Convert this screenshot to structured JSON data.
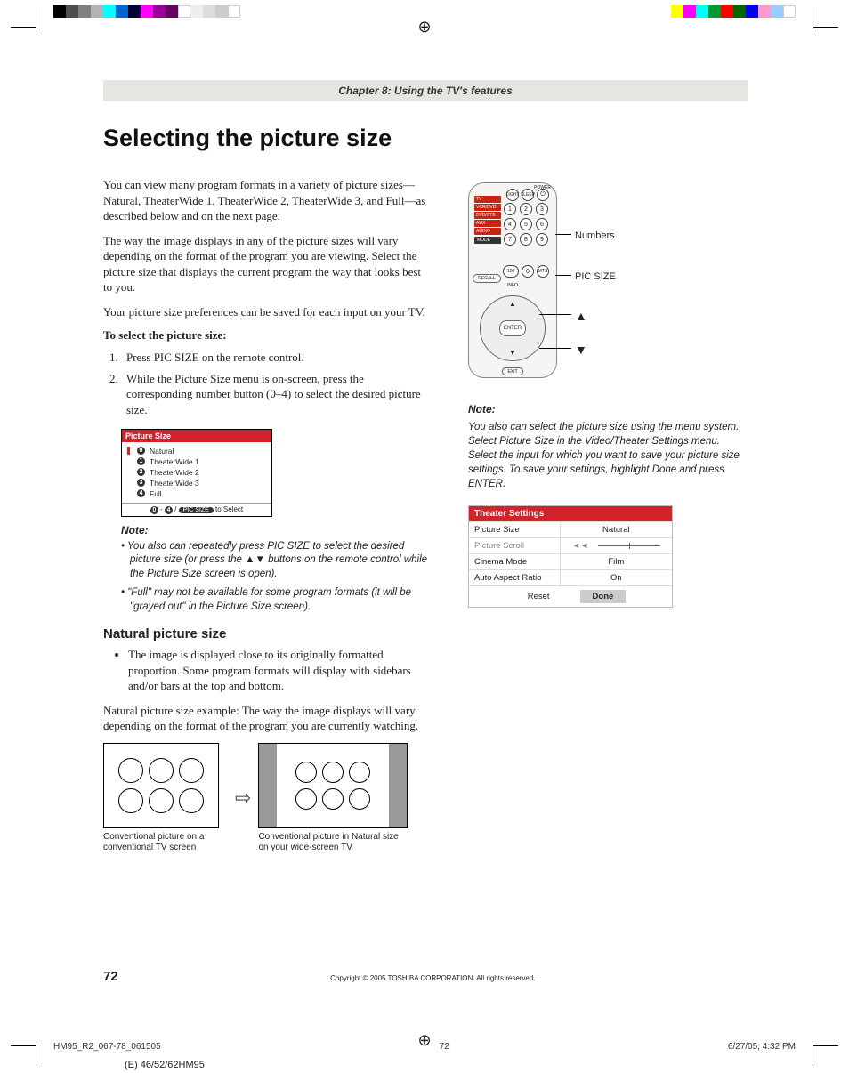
{
  "chapter": "Chapter 8: Using the TV's features",
  "title": "Selecting the picture size",
  "intro": {
    "p1": "You can view many program formats in a variety of picture sizes—Natural, TheaterWide 1, TheaterWide 2, TheaterWide 3, and Full—as described below and on the next page.",
    "p2": "The way the image displays in any of the picture sizes will vary depending on the format of the program you are viewing. Select the picture size that displays the current program the way that looks best to you.",
    "p3": "Your picture size preferences can be saved for each input on your TV."
  },
  "procedure": {
    "heading": "To select the picture size:",
    "s1": "Press PIC SIZE on the remote control.",
    "s2": "While the Picture Size menu is on-screen, press the corresponding number button (0–4) to select the desired picture size."
  },
  "osd": {
    "title": "Picture Size",
    "items": [
      {
        "num": "0",
        "label": "Natural",
        "hl": true
      },
      {
        "num": "1",
        "label": "TheaterWide 1"
      },
      {
        "num": "2",
        "label": "TheaterWide 2"
      },
      {
        "num": "3",
        "label": "TheaterWide 3"
      },
      {
        "num": "4",
        "label": "Full"
      }
    ],
    "footer_prefix": "0",
    "footer_dash": " - ",
    "footer_num2": "4",
    "footer_sep": " / ",
    "footer_pill": "PIC SIZE",
    "footer_suffix": " to Select"
  },
  "note1": {
    "heading": "Note:",
    "i1": "• You also can repeatedly press PIC SIZE to select the desired picture size (or press the ▲▼ buttons on the remote control while the Picture Size screen is open).",
    "i2": "• \"Full\" may not be available for some program formats (it will be \"grayed out\" in the Picture Size screen)."
  },
  "natural": {
    "heading": "Natural picture size",
    "bullet": "The image is displayed close to its originally formatted proportion. Some program formats will display with sidebars and/or bars at the top and bottom.",
    "example": "Natural picture size example: The way the image displays will vary depending on the format of the program you are currently watching.",
    "cap1": "Conventional picture on a conventional TV screen",
    "cap2": "Conventional picture in Natural size on your wide-screen TV"
  },
  "remote": {
    "inputs": [
      "TV",
      "VCR/DVD",
      "DVD/STB",
      "AUX",
      "AUDIO"
    ],
    "mode": "MODE",
    "top_buttons": [
      "LIGHT",
      "SLEEP",
      "⏻"
    ],
    "power_label": "POWER",
    "enter": "ENTER",
    "exit": "EXIT",
    "recall": "RECALL",
    "info": "INFO",
    "labels": {
      "numbers": "Numbers",
      "picsize": "PIC SIZE",
      "up": "▲",
      "down": "▼"
    },
    "row4": {
      "dash": "100",
      "zero": "0",
      "mts": "MTS"
    }
  },
  "note2": {
    "heading": "Note:",
    "body": "You also can select the picture size using the menu system. Select Picture Size in the Video/Theater Settings menu. Select the input for which you want to save your picture size settings. To save your settings, highlight Done and press ENTER."
  },
  "settings": {
    "title": "Theater Settings",
    "rows": [
      {
        "label": "Picture Size",
        "value": "Natural"
      },
      {
        "label": "Picture Scroll",
        "value": "slider",
        "gray": true
      },
      {
        "label": "Cinema Mode",
        "value": "Film"
      },
      {
        "label": "Auto Aspect Ratio",
        "value": "On"
      }
    ],
    "reset": "Reset",
    "done": "Done"
  },
  "footer": {
    "page": "72",
    "copyright": "Copyright © 2005 TOSHIBA CORPORATION. All rights reserved."
  },
  "slug": {
    "file": "HM95_R2_067-78_061505",
    "pg": "72",
    "date": "6/27/05, 4:32 PM",
    "model": "(E) 46/52/62HM95"
  }
}
